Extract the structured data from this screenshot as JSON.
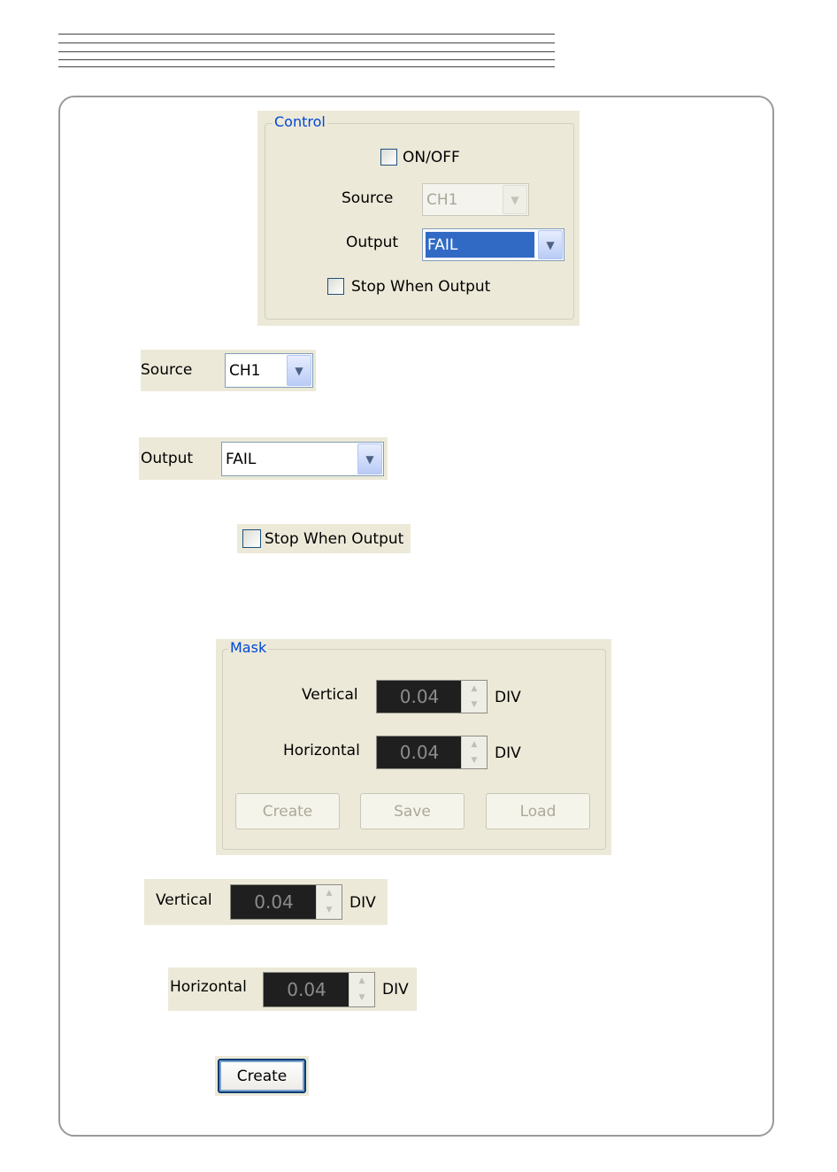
{
  "control_panel": {
    "legend": "Control",
    "onoff_label": "ON/OFF",
    "source_label": "Source",
    "source_value": "CH1",
    "output_label": "Output",
    "output_value": "FAIL",
    "stop_label": "Stop When Output"
  },
  "source_crop": {
    "label": "Source",
    "value": "CH1"
  },
  "output_crop": {
    "label": "Output",
    "value": "FAIL"
  },
  "stop_crop": {
    "label": "Stop When Output"
  },
  "mask_panel": {
    "legend": "Mask",
    "vertical_label": "Vertical",
    "vertical_value": "0.04",
    "vertical_unit": "DIV",
    "horizontal_label": "Horizontal",
    "horizontal_value": "0.04",
    "horizontal_unit": "DIV",
    "create_label": "Create",
    "save_label": "Save",
    "load_label": "Load"
  },
  "vertical_crop": {
    "label": "Vertical",
    "value": "0.04",
    "unit": "DIV"
  },
  "horizontal_crop": {
    "label": "Horizontal",
    "value": "0.04",
    "unit": "DIV"
  },
  "create_crop": {
    "label": "Create"
  },
  "colors": {
    "panel_bg": "#ece9d8",
    "legend_blue": "#0046d5",
    "selection_blue": "#316ac5",
    "spin_bg": "#1f1f1f"
  }
}
